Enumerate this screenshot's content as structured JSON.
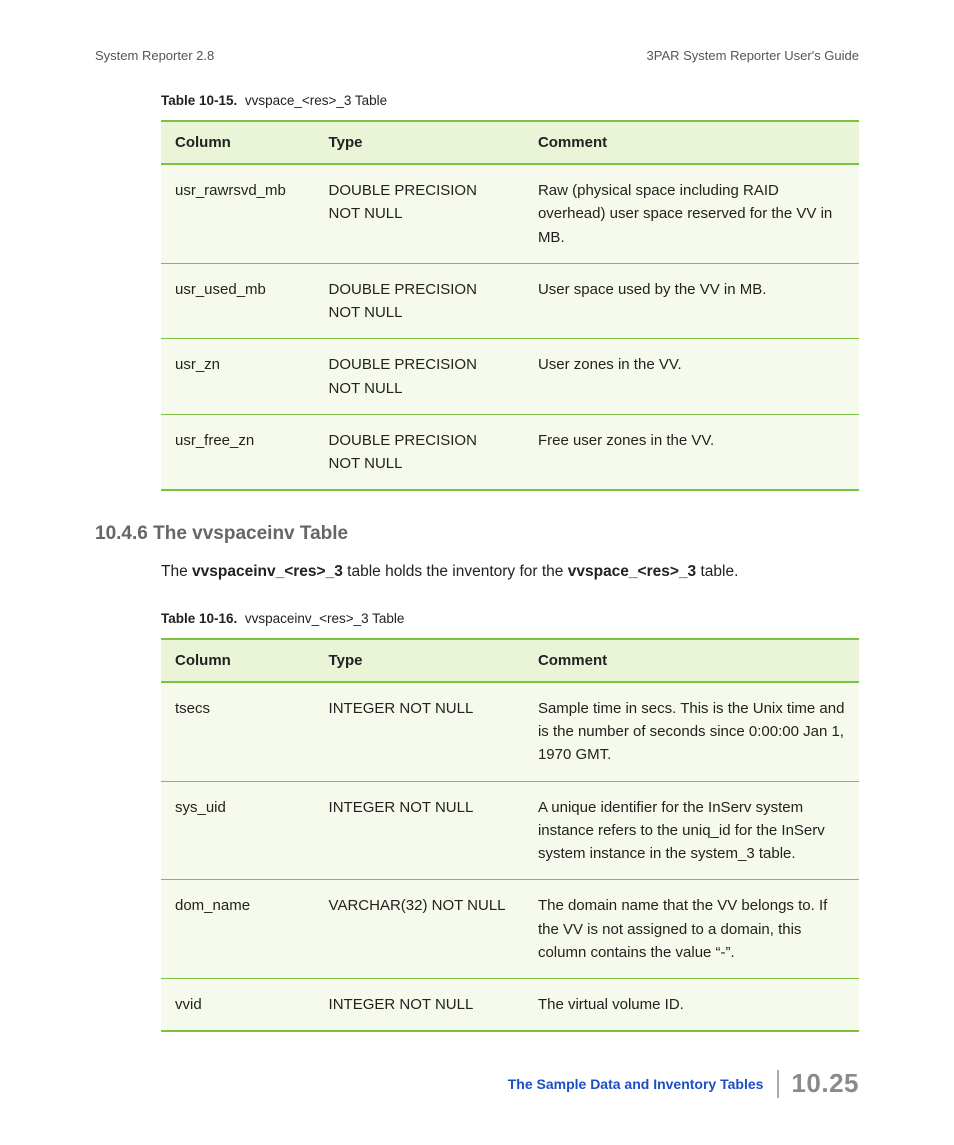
{
  "header": {
    "left": "System Reporter 2.8",
    "right": "3PAR System Reporter User's Guide"
  },
  "table1": {
    "caption_label": "Table 10-15.",
    "caption_text": "vvspace_<res>_3 Table",
    "headers": {
      "c1": "Column",
      "c2": "Type",
      "c3": "Comment"
    },
    "rows": [
      {
        "c1": "usr_rawrsvd_mb",
        "c2": "DOUBLE PRECISION NOT NULL",
        "c3": "Raw (physical space including RAID overhead) user space reserved for the VV in MB."
      },
      {
        "c1": "usr_used_mb",
        "c2": "DOUBLE PRECISION NOT NULL",
        "c3": "User space used by the VV in MB."
      },
      {
        "c1": "usr_zn",
        "c2": "DOUBLE PRECISION NOT NULL",
        "c3": "User zones in the VV."
      },
      {
        "c1": "usr_free_zn",
        "c2": "DOUBLE PRECISION NOT NULL",
        "c3": "Free user zones in the VV."
      }
    ]
  },
  "section": {
    "heading": "10.4.6 The vvspaceinv Table",
    "intro_pre": "The ",
    "intro_b1": "vvspaceinv_<res>_3",
    "intro_mid": " table holds the inventory for the ",
    "intro_b2": "vvspace_<res>_3",
    "intro_post": " table."
  },
  "table2": {
    "caption_label": "Table 10-16.",
    "caption_text": "vvspaceinv_<res>_3 Table",
    "headers": {
      "c1": "Column",
      "c2": "Type",
      "c3": "Comment"
    },
    "rows": [
      {
        "c1": "tsecs",
        "c2": "INTEGER NOT NULL",
        "c3": "Sample time in secs. This is the Unix time and is the number of seconds since 0:00:00 Jan 1, 1970 GMT."
      },
      {
        "c1": "sys_uid",
        "c2": "INTEGER NOT NULL",
        "c3": "A unique identifier for the InServ system instance refers to the uniq_id for the InServ system instance in the system_3 table."
      },
      {
        "c1": "dom_name",
        "c2": "VARCHAR(32) NOT NULL",
        "c3": "The domain name that the VV belongs to. If the VV is not assigned to a domain, this column contains the value “-”."
      },
      {
        "c1": "vvid",
        "c2": "INTEGER NOT NULL",
        "c3": "The virtual volume ID."
      }
    ]
  },
  "footer": {
    "link": "The Sample Data and Inventory Tables",
    "page": "10.25"
  }
}
